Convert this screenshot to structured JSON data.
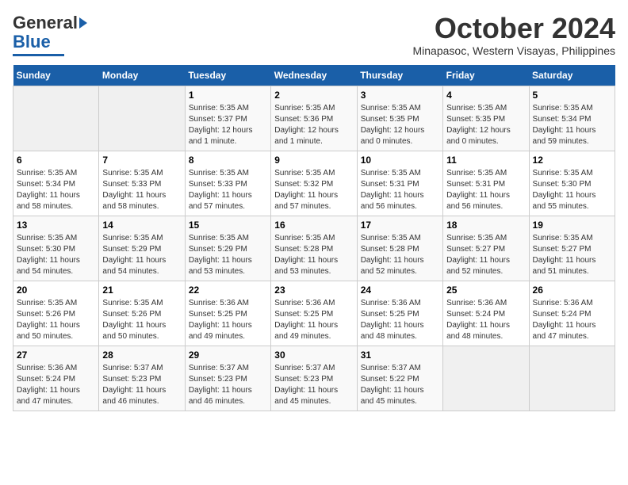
{
  "logo": {
    "line1": "General",
    "line2": "Blue"
  },
  "title": "October 2024",
  "location": "Minapasoc, Western Visayas, Philippines",
  "weekdays": [
    "Sunday",
    "Monday",
    "Tuesday",
    "Wednesday",
    "Thursday",
    "Friday",
    "Saturday"
  ],
  "weeks": [
    [
      {
        "day": "",
        "info": ""
      },
      {
        "day": "",
        "info": ""
      },
      {
        "day": "1",
        "info": "Sunrise: 5:35 AM\nSunset: 5:37 PM\nDaylight: 12 hours\nand 1 minute."
      },
      {
        "day": "2",
        "info": "Sunrise: 5:35 AM\nSunset: 5:36 PM\nDaylight: 12 hours\nand 1 minute."
      },
      {
        "day": "3",
        "info": "Sunrise: 5:35 AM\nSunset: 5:35 PM\nDaylight: 12 hours\nand 0 minutes."
      },
      {
        "day": "4",
        "info": "Sunrise: 5:35 AM\nSunset: 5:35 PM\nDaylight: 12 hours\nand 0 minutes."
      },
      {
        "day": "5",
        "info": "Sunrise: 5:35 AM\nSunset: 5:34 PM\nDaylight: 11 hours\nand 59 minutes."
      }
    ],
    [
      {
        "day": "6",
        "info": "Sunrise: 5:35 AM\nSunset: 5:34 PM\nDaylight: 11 hours\nand 58 minutes."
      },
      {
        "day": "7",
        "info": "Sunrise: 5:35 AM\nSunset: 5:33 PM\nDaylight: 11 hours\nand 58 minutes."
      },
      {
        "day": "8",
        "info": "Sunrise: 5:35 AM\nSunset: 5:33 PM\nDaylight: 11 hours\nand 57 minutes."
      },
      {
        "day": "9",
        "info": "Sunrise: 5:35 AM\nSunset: 5:32 PM\nDaylight: 11 hours\nand 57 minutes."
      },
      {
        "day": "10",
        "info": "Sunrise: 5:35 AM\nSunset: 5:31 PM\nDaylight: 11 hours\nand 56 minutes."
      },
      {
        "day": "11",
        "info": "Sunrise: 5:35 AM\nSunset: 5:31 PM\nDaylight: 11 hours\nand 56 minutes."
      },
      {
        "day": "12",
        "info": "Sunrise: 5:35 AM\nSunset: 5:30 PM\nDaylight: 11 hours\nand 55 minutes."
      }
    ],
    [
      {
        "day": "13",
        "info": "Sunrise: 5:35 AM\nSunset: 5:30 PM\nDaylight: 11 hours\nand 54 minutes."
      },
      {
        "day": "14",
        "info": "Sunrise: 5:35 AM\nSunset: 5:29 PM\nDaylight: 11 hours\nand 54 minutes."
      },
      {
        "day": "15",
        "info": "Sunrise: 5:35 AM\nSunset: 5:29 PM\nDaylight: 11 hours\nand 53 minutes."
      },
      {
        "day": "16",
        "info": "Sunrise: 5:35 AM\nSunset: 5:28 PM\nDaylight: 11 hours\nand 53 minutes."
      },
      {
        "day": "17",
        "info": "Sunrise: 5:35 AM\nSunset: 5:28 PM\nDaylight: 11 hours\nand 52 minutes."
      },
      {
        "day": "18",
        "info": "Sunrise: 5:35 AM\nSunset: 5:27 PM\nDaylight: 11 hours\nand 52 minutes."
      },
      {
        "day": "19",
        "info": "Sunrise: 5:35 AM\nSunset: 5:27 PM\nDaylight: 11 hours\nand 51 minutes."
      }
    ],
    [
      {
        "day": "20",
        "info": "Sunrise: 5:35 AM\nSunset: 5:26 PM\nDaylight: 11 hours\nand 50 minutes."
      },
      {
        "day": "21",
        "info": "Sunrise: 5:35 AM\nSunset: 5:26 PM\nDaylight: 11 hours\nand 50 minutes."
      },
      {
        "day": "22",
        "info": "Sunrise: 5:36 AM\nSunset: 5:25 PM\nDaylight: 11 hours\nand 49 minutes."
      },
      {
        "day": "23",
        "info": "Sunrise: 5:36 AM\nSunset: 5:25 PM\nDaylight: 11 hours\nand 49 minutes."
      },
      {
        "day": "24",
        "info": "Sunrise: 5:36 AM\nSunset: 5:25 PM\nDaylight: 11 hours\nand 48 minutes."
      },
      {
        "day": "25",
        "info": "Sunrise: 5:36 AM\nSunset: 5:24 PM\nDaylight: 11 hours\nand 48 minutes."
      },
      {
        "day": "26",
        "info": "Sunrise: 5:36 AM\nSunset: 5:24 PM\nDaylight: 11 hours\nand 47 minutes."
      }
    ],
    [
      {
        "day": "27",
        "info": "Sunrise: 5:36 AM\nSunset: 5:24 PM\nDaylight: 11 hours\nand 47 minutes."
      },
      {
        "day": "28",
        "info": "Sunrise: 5:37 AM\nSunset: 5:23 PM\nDaylight: 11 hours\nand 46 minutes."
      },
      {
        "day": "29",
        "info": "Sunrise: 5:37 AM\nSunset: 5:23 PM\nDaylight: 11 hours\nand 46 minutes."
      },
      {
        "day": "30",
        "info": "Sunrise: 5:37 AM\nSunset: 5:23 PM\nDaylight: 11 hours\nand 45 minutes."
      },
      {
        "day": "31",
        "info": "Sunrise: 5:37 AM\nSunset: 5:22 PM\nDaylight: 11 hours\nand 45 minutes."
      },
      {
        "day": "",
        "info": ""
      },
      {
        "day": "",
        "info": ""
      }
    ]
  ]
}
